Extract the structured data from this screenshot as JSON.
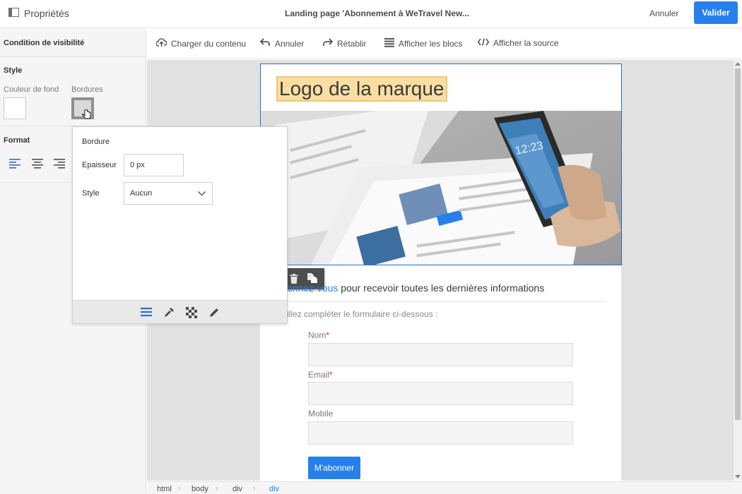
{
  "topbar": {
    "panel_title": "Propriétés",
    "document_title": "Landing page 'Abonnement à WeTravel New...",
    "cancel_label": "Annuler",
    "validate_label": "Valider",
    "validate_color": "#2680eb"
  },
  "properties": {
    "visibility_condition": "Condition de visibilité",
    "style_heading": "Style",
    "bg_color_label": "Couleur de fond",
    "borders_label": "Bordures",
    "format_heading": "Format",
    "align_icons": [
      "align-left-icon",
      "align-center-icon",
      "align-right-icon"
    ]
  },
  "border_popover": {
    "title": "Bordure",
    "thickness_label": "Epaisseur",
    "thickness_value": "0 px",
    "style_label": "Style",
    "style_value": "Aucun",
    "footer_icons": [
      "lines-icon",
      "eyedropper-icon",
      "checkerboard-icon",
      "pencil-icon"
    ]
  },
  "toolbar": {
    "upload_label": "Charger du contenu",
    "undo_label": "Annuler",
    "redo_label": "Rétablir",
    "blocks_label": "Afficher les blocs",
    "source_label": "Afficher la source"
  },
  "email": {
    "logo_text": "Logo de la marque",
    "headline_link": "onnez-vous",
    "headline_rest": " pour recevoir toutes les dernières informations",
    "instruction": "illez compléter le formulaire ci-dessous :",
    "fields": [
      {
        "label": "Nom",
        "required": "*"
      },
      {
        "label": "Email",
        "required": "*"
      },
      {
        "label": "Mobile",
        "required": ""
      }
    ],
    "subscribe_label": "M'abonner"
  },
  "breadcrumb": [
    "html",
    "body",
    "div",
    "div"
  ]
}
